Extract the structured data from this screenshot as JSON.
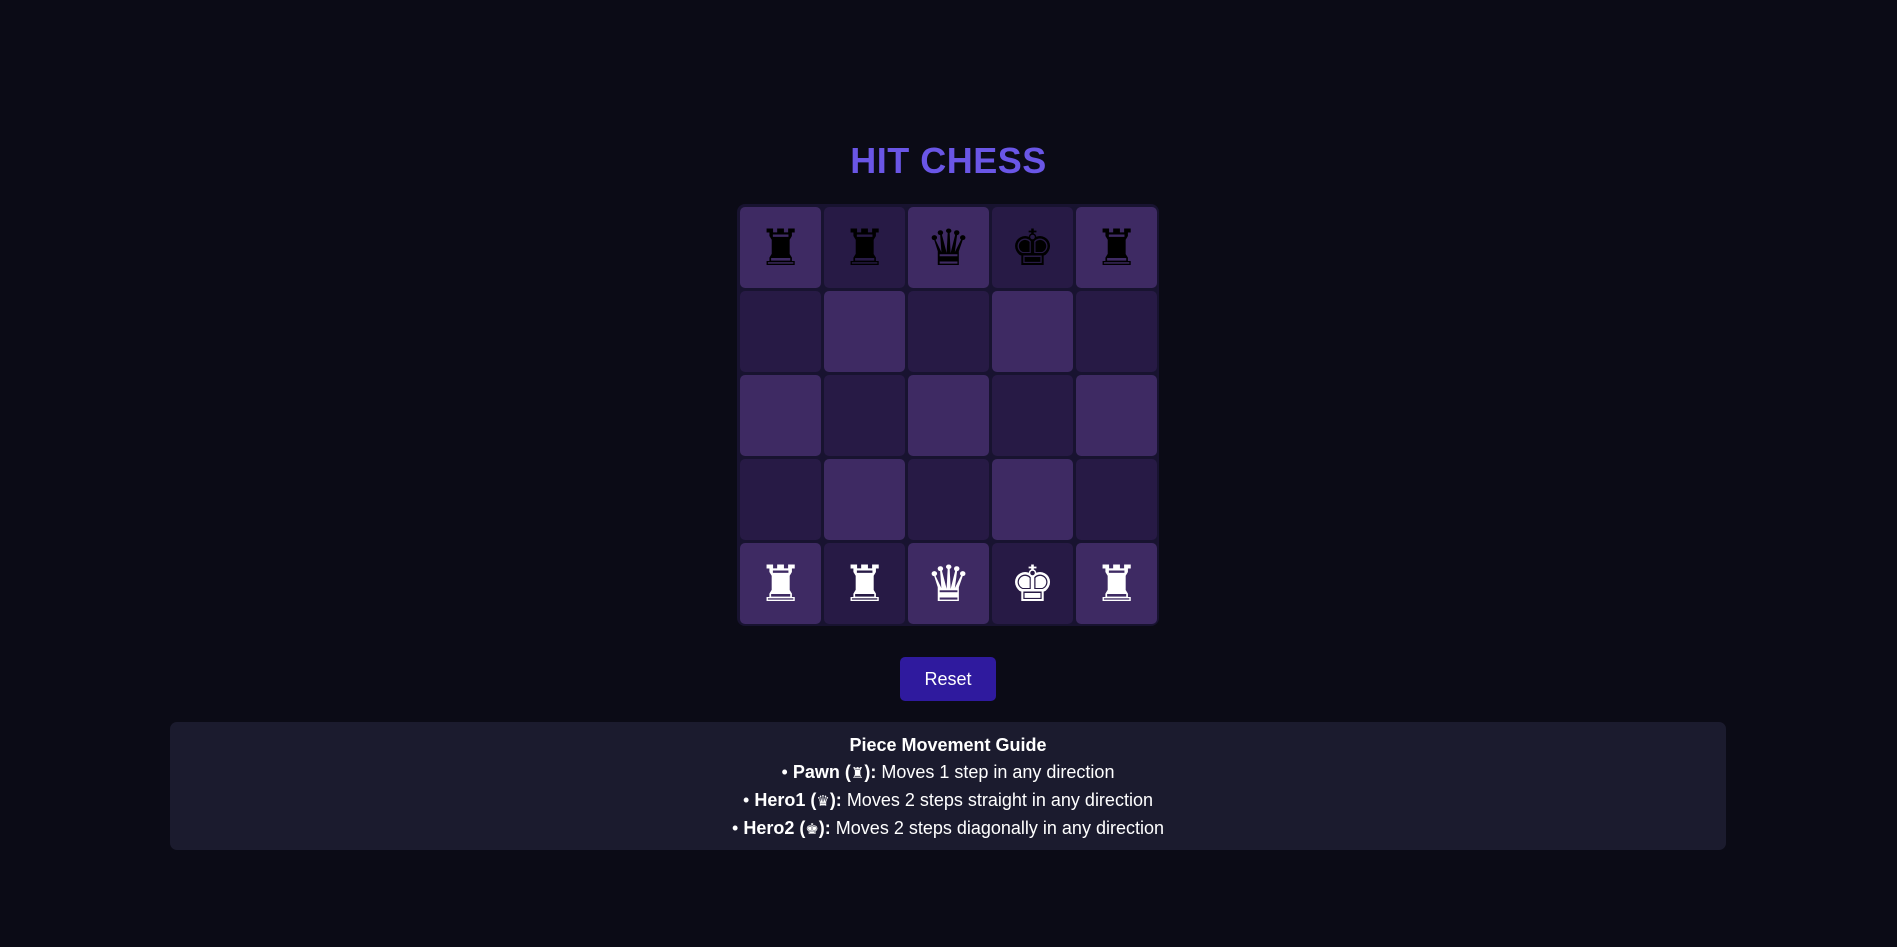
{
  "title": "HIT CHESS",
  "board": {
    "rows": [
      [
        {
          "shade": "light",
          "piece": "♜",
          "color": "black",
          "name": "rook"
        },
        {
          "shade": "dark",
          "piece": "♜",
          "color": "black",
          "name": "rook"
        },
        {
          "shade": "light",
          "piece": "♛",
          "color": "black",
          "name": "queen"
        },
        {
          "shade": "dark",
          "piece": "♚",
          "color": "black",
          "name": "king"
        },
        {
          "shade": "light",
          "piece": "♜",
          "color": "black",
          "name": "rook"
        }
      ],
      [
        {
          "shade": "dark",
          "piece": ""
        },
        {
          "shade": "light",
          "piece": ""
        },
        {
          "shade": "dark",
          "piece": ""
        },
        {
          "shade": "light",
          "piece": ""
        },
        {
          "shade": "dark",
          "piece": ""
        }
      ],
      [
        {
          "shade": "light",
          "piece": ""
        },
        {
          "shade": "dark",
          "piece": ""
        },
        {
          "shade": "light",
          "piece": ""
        },
        {
          "shade": "dark",
          "piece": ""
        },
        {
          "shade": "light",
          "piece": ""
        }
      ],
      [
        {
          "shade": "dark",
          "piece": ""
        },
        {
          "shade": "light",
          "piece": ""
        },
        {
          "shade": "dark",
          "piece": ""
        },
        {
          "shade": "light",
          "piece": ""
        },
        {
          "shade": "dark",
          "piece": ""
        }
      ],
      [
        {
          "shade": "light",
          "piece": "♜",
          "color": "white",
          "name": "rook"
        },
        {
          "shade": "dark",
          "piece": "♜",
          "color": "white",
          "name": "rook"
        },
        {
          "shade": "light",
          "piece": "♛",
          "color": "white",
          "name": "queen"
        },
        {
          "shade": "dark",
          "piece": "♚",
          "color": "white",
          "name": "king"
        },
        {
          "shade": "light",
          "piece": "♜",
          "color": "white",
          "name": "rook"
        }
      ]
    ]
  },
  "reset_label": "Reset",
  "guide": {
    "title": "Piece Movement Guide",
    "rows": [
      {
        "bullet": "• ",
        "label": "Pawn (",
        "glyph": "♜",
        "label_end": "):",
        "text": " Moves 1 step in any direction"
      },
      {
        "bullet": "• ",
        "label": "Hero1 (",
        "glyph": "♛",
        "label_end": "):",
        "text": " Moves 2 steps straight in any direction"
      },
      {
        "bullet": "• ",
        "label": "Hero2 (",
        "glyph": "♚",
        "label_end": "):",
        "text": " Moves 2 steps diagonally in any direction"
      }
    ]
  },
  "colors": {
    "title": "#6a56e6",
    "light_square": "#3e2a63",
    "dark_square": "#271a45",
    "reset_button": "#2f1a9e",
    "guide_panel": "#1b1b2e",
    "background": "#0b0b16"
  }
}
